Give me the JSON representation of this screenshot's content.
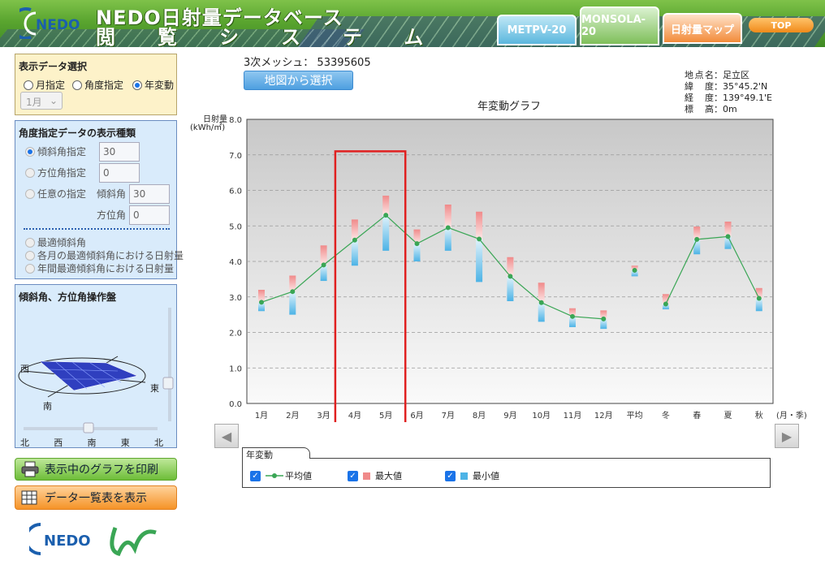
{
  "header": {
    "title_line1": "NEDO日射量データベース",
    "title_line2": "閲覧システム",
    "logo_text": "NEDO",
    "tabs": [
      "METPV-20",
      "MONSOLA-20",
      "日射量マップ",
      "TOP"
    ]
  },
  "display_select": {
    "title": "表示データ選択",
    "options": [
      "月指定",
      "角度指定",
      "年変動"
    ],
    "selected": "年変動",
    "month_value": "1月"
  },
  "angle_panel": {
    "title": "角度指定データの表示種類",
    "tilt_label": "傾斜角指定",
    "tilt_value": "30",
    "azimuth_label": "方位角指定",
    "azimuth_value": "0",
    "arbitrary_label": "任意の指定",
    "arb_tilt_label": "傾斜角",
    "arb_tilt_value": "30",
    "arb_azimuth_label": "方位角",
    "arb_azimuth_value": "0",
    "opt1": "最適傾斜角",
    "opt2": "各月の最適傾斜角における日射量",
    "opt3": "年間最適傾斜角における日射量"
  },
  "control_panel": {
    "title": "傾斜角、方位角操作盤",
    "west": "西",
    "east": "東",
    "south": "南",
    "scale": [
      "北",
      "西",
      "南",
      "東",
      "北"
    ]
  },
  "buttons": {
    "print": "表示中のグラフを印刷",
    "list": "データ一覧表を表示"
  },
  "mesh_label": "3次メッシュ：",
  "mesh_code": "53395605",
  "map_select_label": "地図から選択",
  "location": {
    "name_k": "地点名",
    "name": "足立区",
    "lat_k": "緯度",
    "lat": "35°45.2'N",
    "lon_k": "経度",
    "lon": "139°49.1'E",
    "alt_k": "標高",
    "alt": "0m"
  },
  "legend": {
    "tab": "年変動",
    "avg": "平均値",
    "max": "最大値",
    "min": "最小値"
  },
  "colors": {
    "avg_line": "#3aa655",
    "max_bar": "#f08a8a",
    "min_bar": "#4cb3e6",
    "highlight": "#e02020"
  },
  "chart_data": {
    "type": "line",
    "title": "年変動グラフ",
    "ylabel": "日射量\n(kWh/㎡)",
    "xlabel": "(月・季)",
    "ylim": [
      0,
      8
    ],
    "yticks": [
      "0.0",
      "1.0",
      "2.0",
      "3.0",
      "4.0",
      "5.0",
      "6.0",
      "7.0",
      "8.0"
    ],
    "categories": [
      "1月",
      "2月",
      "3月",
      "4月",
      "5月",
      "6月",
      "7月",
      "8月",
      "9月",
      "10月",
      "11月",
      "12月",
      "平均",
      "冬",
      "春",
      "夏",
      "秋"
    ],
    "series": [
      {
        "name": "平均値",
        "values": [
          2.85,
          3.15,
          3.9,
          4.6,
          5.3,
          4.5,
          4.95,
          4.63,
          3.58,
          2.84,
          2.45,
          2.38,
          3.75,
          2.8,
          4.62,
          4.7,
          2.96
        ]
      },
      {
        "name": "最大値",
        "values": [
          3.2,
          3.6,
          4.45,
          5.18,
          5.85,
          4.9,
          5.6,
          5.4,
          4.12,
          3.4,
          2.68,
          2.62,
          3.88,
          3.08,
          4.98,
          5.12,
          3.25
        ]
      },
      {
        "name": "最小値",
        "values": [
          2.6,
          2.5,
          3.45,
          3.88,
          4.3,
          4.0,
          4.3,
          3.42,
          2.88,
          2.3,
          2.15,
          2.1,
          3.58,
          2.65,
          4.2,
          4.35,
          2.6
        ]
      }
    ],
    "highlight_categories": [
      "4月",
      "5月"
    ],
    "grid": true
  }
}
